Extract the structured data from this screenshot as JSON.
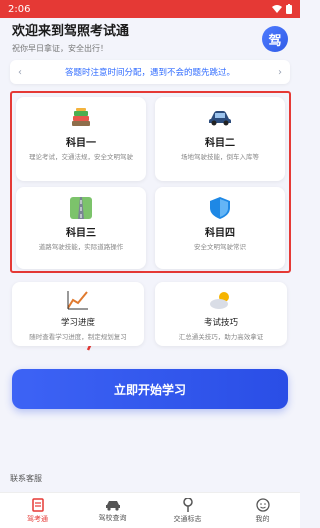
{
  "status_bar": {
    "time": "2:06"
  },
  "header": {
    "title": "欢迎来到驾照考试通",
    "subtitle": "祝你早日拿证，安全出行！",
    "logo_text": "驾"
  },
  "notice": {
    "text": "答题时注意时间分配，遇到不会的题先跳过。"
  },
  "subjects": [
    {
      "title": "科目一",
      "desc": "理论考试，交通法规，安全文明驾驶",
      "icon": "books-icon"
    },
    {
      "title": "科目二",
      "desc": "场地驾驶技能，倒车入库等",
      "icon": "car-icon"
    },
    {
      "title": "科目三",
      "desc": "道路驾驶技能，实际道路操作",
      "icon": "road-icon"
    },
    {
      "title": "科目四",
      "desc": "安全文明驾驶常识",
      "icon": "shield-icon"
    }
  ],
  "features": [
    {
      "title": "学习进度",
      "desc": "随时查看学习进度，制定规划复习",
      "icon": "chart-icon"
    },
    {
      "title": "考试技巧",
      "desc": "汇总通关技巧，助力高效拿证",
      "icon": "weather-icon"
    }
  ],
  "start_button": {
    "label": "立即开始学习"
  },
  "contact": {
    "label": "联系客服"
  },
  "bottom_nav": [
    {
      "label": "驾考通",
      "active": true
    },
    {
      "label": "驾校查询",
      "active": false
    },
    {
      "label": "交通标志",
      "active": false
    },
    {
      "label": "我的",
      "active": false
    }
  ],
  "colors": {
    "accent": "#2f5be7",
    "highlight": "#e53935",
    "background": "#f3f4fb"
  }
}
